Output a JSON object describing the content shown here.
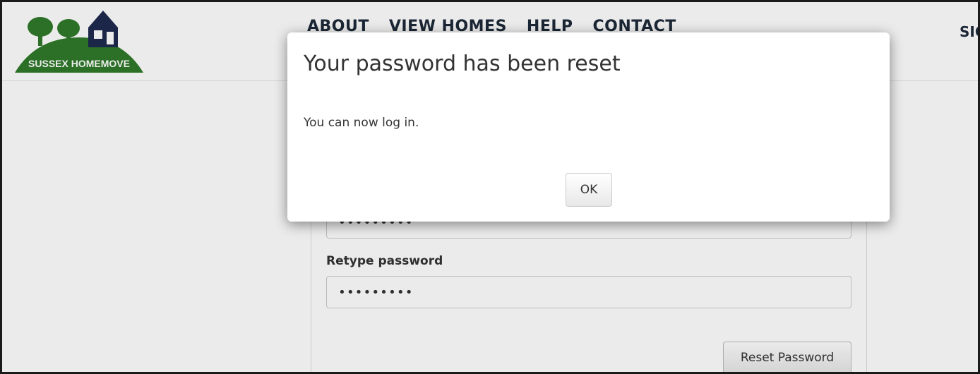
{
  "brand": {
    "logo_text": "SUSSEX HOMEMOVE",
    "colors": {
      "green": "#2f7a2a",
      "navy": "#1e2a4f"
    }
  },
  "nav": {
    "links": [
      "ABOUT",
      "VIEW HOMES",
      "HELP",
      "CONTACT"
    ],
    "signin": "SIGN IN"
  },
  "form": {
    "password_value": "•••••••••",
    "retype_label": "Retype password",
    "retype_value": "•••••••••",
    "reset_button": "Reset Password"
  },
  "dialog": {
    "title": "Your password has been reset",
    "message": "You can now log in.",
    "ok_button": "OK"
  }
}
